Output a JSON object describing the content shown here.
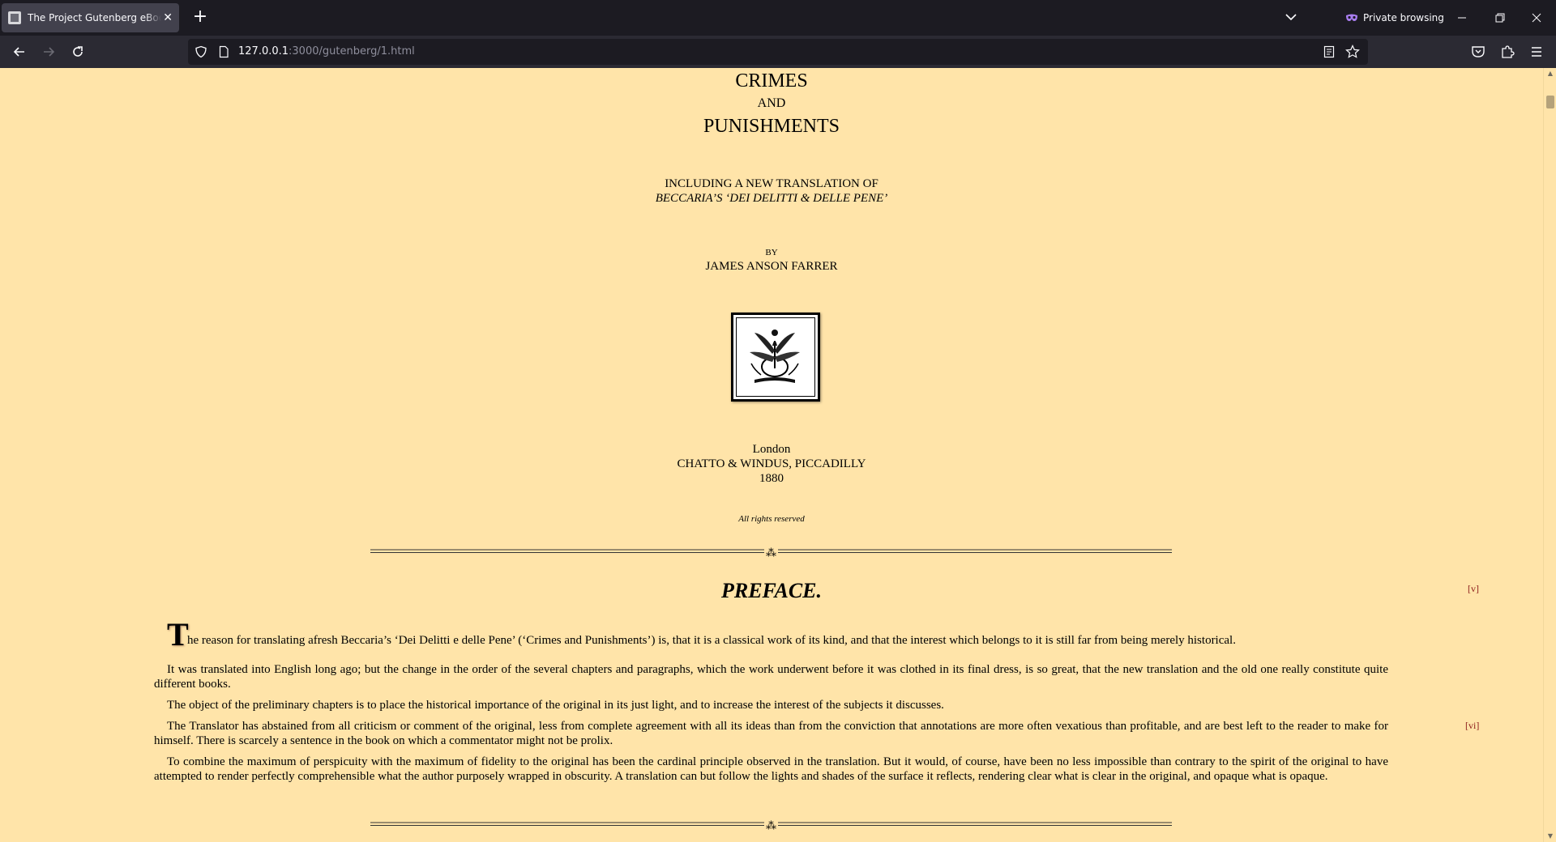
{
  "browser": {
    "tab_title": "The Project Gutenberg eBook of Crimes and Punishments",
    "new_tab_icon": "plus-icon",
    "private_label": "Private browsing",
    "url_host": "127.0.0.1",
    "url_path": ":3000/gutenberg/1.html"
  },
  "title_page": {
    "title_line1": "CRIMES",
    "title_line2": "AND",
    "title_line3": "PUNISHMENTS",
    "subtitle_line1": "INCLUDING A NEW TRANSLATION OF",
    "subtitle_line2": "BECCARIA’S ‘DEI DELITTI & DELLE PENE’",
    "by": "BY",
    "author": "JAMES ANSON FARRER",
    "place": "London",
    "publisher": "CHATTO & WINDUS, PICCADILLY",
    "year": "1880",
    "rights": "All rights reserved"
  },
  "preface": {
    "heading": "PREFACE.",
    "page_marker_1": "[v]",
    "page_marker_2": "[vi]",
    "dropcap": "T",
    "p1": "he reason for translating afresh Beccaria’s ‘Dei Delitti e delle Pene’ (‘Crimes and Punishments’) is, that it is a classical work of its kind, and that the interest which belongs to it is still far from being merely historical.",
    "p2": "It was translated into English long ago; but the change in the order of the several chapters and paragraphs, which the work underwent before it was clothed in its final dress, is so great, that the new translation and the old one really constitute quite different books.",
    "p3": "The object of the preliminary chapters is to place the historical importance of the original in its just light, and to increase the interest of the subjects it discusses.",
    "p4": "The Translator has abstained from all criticism or comment of the original, less from complete agreement with all its ideas than from the conviction that annotations are more often vexatious than profitable, and are best left to the reader to make for himself. There is scarcely a sentence in the book on which a commentator might not be prolix.",
    "p5": "To combine the maximum of perspicuity with the maximum of fidelity to the original has been the cardinal principle observed in the translation. But it would, of course, have been no less impossible than contrary to the spirit of the original to have attempted to render perfectly comprehensible what the author purposely wrapped in obscurity. A translation can but follow the lights and shades of the surface it reflects, rendering clear what is clear in the original, and opaque what is opaque."
  },
  "colors": {
    "page_background": "#ffe4a9",
    "page_marker": "#8b1a1a",
    "chrome_dark": "#1c1b22",
    "chrome_toolbar": "#2b2a33"
  }
}
